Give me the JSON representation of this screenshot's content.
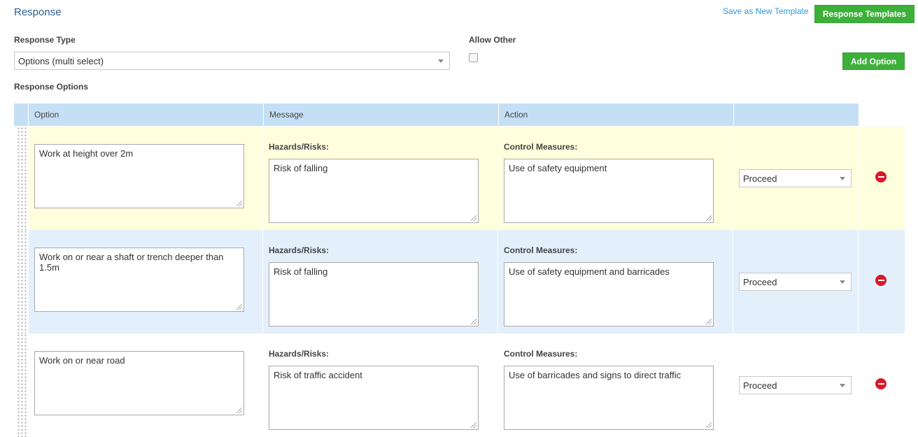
{
  "header": {
    "title": "Response",
    "save_template_label": "Save as New Template",
    "response_templates_label": "Response Templates"
  },
  "form": {
    "response_type_label": "Response Type",
    "response_type_value": "Options (multi select)",
    "allow_other_label": "Allow Other",
    "allow_other_checked": false,
    "add_option_label": "Add Option",
    "response_options_label": "Response Options"
  },
  "table": {
    "columns": [
      "Option",
      "Message",
      "Action"
    ],
    "rows": [
      {
        "option": "Work at height over 2m",
        "hazards_label": "Hazards/Risks:",
        "hazards": "Risk of falling",
        "control_label": "Control Measures:",
        "control": "Use of safety equipment",
        "action": "Proceed",
        "bg": "#ffffdd"
      },
      {
        "option": "Work on or near a shaft or trench deeper than 1.5m",
        "hazards_label": "Hazards/Risks:",
        "hazards": "Risk of falling",
        "control_label": "Control Measures:",
        "control": "Use of safety equipment and barricades",
        "action": "Proceed",
        "bg": "#e3f0fc"
      },
      {
        "option": "Work on or near road",
        "hazards_label": "Hazards/Risks:",
        "hazards": "Risk of traffic accident",
        "control_label": "Control Measures:",
        "control": "Use of barricades and signs to direct traffic",
        "action": "Proceed",
        "bg": "#ffffff"
      }
    ]
  },
  "colors": {
    "accent_green": "#3db03a",
    "header_blue": "#c5e0f5",
    "title_blue": "#2a5d8f",
    "link_blue": "#2e9bd6",
    "remove_red": "#d9182a"
  }
}
